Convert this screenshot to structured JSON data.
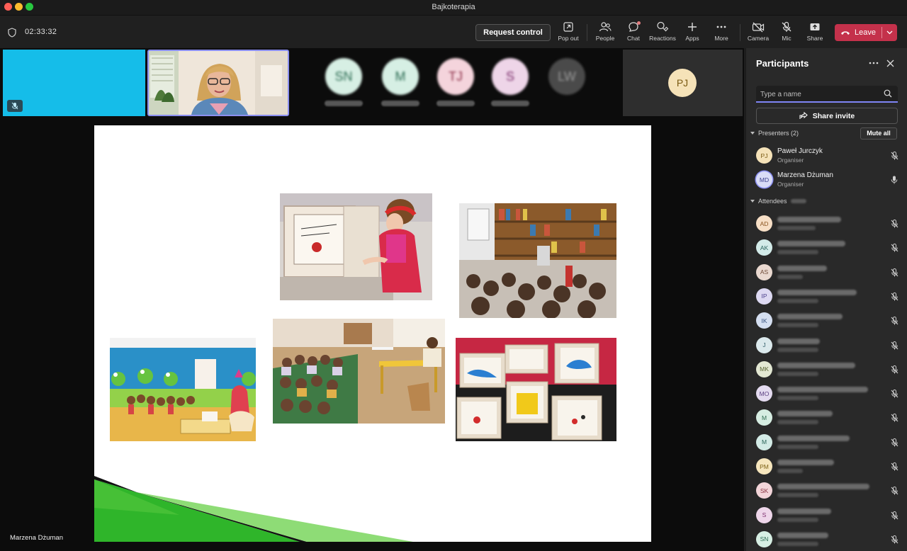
{
  "window": {
    "title": "Bajkoterapia"
  },
  "toolbar": {
    "timer": "02:33:32",
    "request_control": "Request control",
    "items": [
      {
        "label": "Pop out",
        "icon": "pop-out-icon"
      },
      {
        "label": "People",
        "icon": "people-icon",
        "active": true
      },
      {
        "label": "Chat",
        "icon": "chat-icon"
      },
      {
        "label": "Reactions",
        "icon": "reactions-icon"
      },
      {
        "label": "Apps",
        "icon": "apps-icon"
      },
      {
        "label": "More",
        "icon": "more-icon"
      },
      {
        "label": "Camera",
        "icon": "camera-off-icon"
      },
      {
        "label": "Mic",
        "icon": "mic-off-icon"
      },
      {
        "label": "Share",
        "icon": "share-icon"
      }
    ],
    "leave": "Leave"
  },
  "stage": {
    "strip_people": [
      {
        "initials": "SN",
        "bg": "#d7efe4",
        "fg": "#2b6b52"
      },
      {
        "initials": "M",
        "bg": "#d6efe4",
        "fg": "#2b6b52"
      },
      {
        "initials": "TJ",
        "bg": "#f4d4dc",
        "fg": "#8a2c45"
      },
      {
        "initials": "S",
        "bg": "#eed5e8",
        "fg": "#7a2c6a"
      },
      {
        "initials": "LW",
        "bg": "#4a4a4a",
        "fg": "#9a9a9a"
      }
    ],
    "pinned_initials": "PJ",
    "presenter": "Marzena Dżuman"
  },
  "panel": {
    "title": "Participants",
    "search_placeholder": "Type a name",
    "share_invite": "Share invite",
    "presenters_header": "Presenters (2)",
    "mute_all": "Mute all",
    "attendees_header": "Attendees",
    "presenters": [
      {
        "initials": "PJ",
        "name": "Paweł Jurczyk",
        "role": "Organiser",
        "bg": "#f5e2b8",
        "fg": "#7a5a12",
        "mic": "muted"
      },
      {
        "initials": "MD",
        "name": "Marzena Dżuman",
        "role": "Organiser",
        "bg": "#d9dcf6",
        "fg": "#3b3f8a",
        "mic": "on"
      }
    ],
    "attendees": [
      {
        "initials": "AD",
        "bg": "#f7dfc6",
        "fg": "#8a5520"
      },
      {
        "initials": "AK",
        "bg": "#d3ebe9",
        "fg": "#27625c"
      },
      {
        "initials": "AS",
        "bg": "#ead9d0",
        "fg": "#6e4a36"
      },
      {
        "initials": "IP",
        "bg": "#ddd9f2",
        "fg": "#4a3f8a"
      },
      {
        "initials": "IK",
        "bg": "#d5dff1",
        "fg": "#34507e"
      },
      {
        "initials": "J",
        "bg": "#dbe9ec",
        "fg": "#35606a"
      },
      {
        "initials": "MK",
        "bg": "#e3e8d3",
        "fg": "#566230"
      },
      {
        "initials": "MO",
        "bg": "#e4dbf0",
        "fg": "#5a3e80"
      },
      {
        "initials": "M",
        "bg": "#d6ede2",
        "fg": "#2e6a50"
      },
      {
        "initials": "M",
        "bg": "#d3ebe6",
        "fg": "#2b6459"
      },
      {
        "initials": "PM",
        "bg": "#f6e6bd",
        "fg": "#7c6116"
      },
      {
        "initials": "SK",
        "bg": "#f3d5d9",
        "fg": "#87303f"
      },
      {
        "initials": "S",
        "bg": "#eed6ea",
        "fg": "#7c2d6d"
      },
      {
        "initials": "SN",
        "bg": "#d7efe4",
        "fg": "#2b6b52"
      }
    ]
  }
}
